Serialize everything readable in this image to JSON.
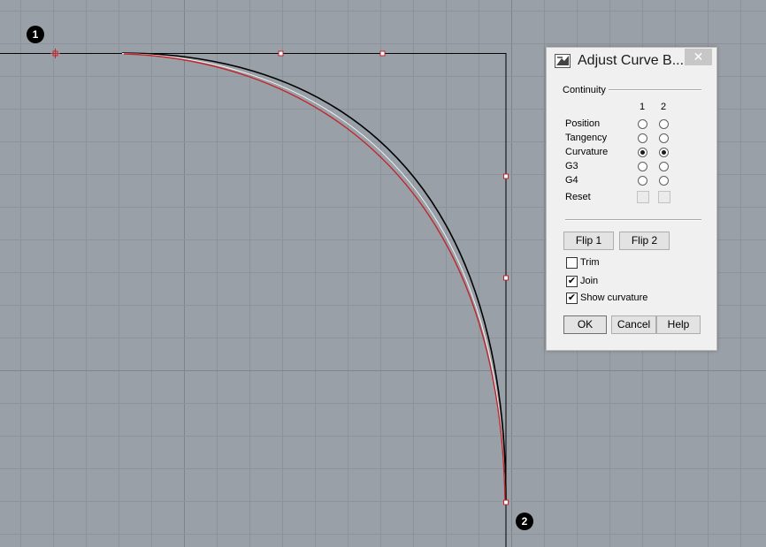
{
  "viewport": {
    "marker_1": "1",
    "marker_2": "2"
  },
  "dialog": {
    "title": "Adjust Curve B...",
    "close_label": "✕",
    "continuity_group": "Continuity",
    "column_1": "1",
    "column_2": "2",
    "rows": [
      {
        "label": "Position",
        "col1": false,
        "col2": false
      },
      {
        "label": "Tangency",
        "col1": false,
        "col2": false
      },
      {
        "label": "Curvature",
        "col1": true,
        "col2": true
      },
      {
        "label": "G3",
        "col1": false,
        "col2": false
      },
      {
        "label": "G4",
        "col1": false,
        "col2": false
      }
    ],
    "reset_label": "Reset",
    "flip1_label": "Flip 1",
    "flip2_label": "Flip 2",
    "trim_label": "Trim",
    "trim_checked": false,
    "join_label": "Join",
    "join_checked": true,
    "show_curvature_label": "Show curvature",
    "show_curvature_checked": true,
    "ok_label": "OK",
    "cancel_label": "Cancel",
    "help_label": "Help"
  },
  "colors": {
    "background": "#9aa0a7",
    "grid_minor": "#8c939a",
    "grid_major": "#7d848b",
    "curve_black": "#000000",
    "curve_red": "#c0272d",
    "control_point": "#c0272d"
  }
}
